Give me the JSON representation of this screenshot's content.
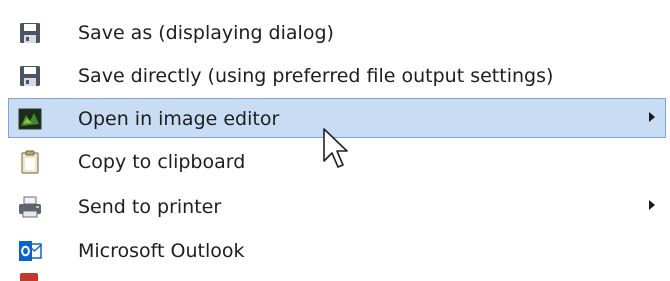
{
  "menu": {
    "items": [
      {
        "icon": "floppy-disk-icon",
        "label": "Save as (displaying dialog)",
        "has_submenu": false,
        "highlighted": false
      },
      {
        "icon": "floppy-disk-icon",
        "label": "Save directly (using preferred file output settings)",
        "has_submenu": false,
        "highlighted": false
      },
      {
        "icon": "image-editor-icon",
        "label": "Open in image editor",
        "has_submenu": true,
        "highlighted": true
      },
      {
        "icon": "clipboard-icon",
        "label": "Copy to clipboard",
        "has_submenu": false,
        "highlighted": false
      },
      {
        "icon": "printer-icon",
        "label": "Send to printer",
        "has_submenu": true,
        "highlighted": false
      },
      {
        "icon": "outlook-icon",
        "label": "Microsoft Outlook",
        "has_submenu": false,
        "highlighted": false
      }
    ]
  },
  "colors": {
    "highlight_bg": "#c8dcf4",
    "highlight_border": "#7aa7d8",
    "text": "#1e1e1e",
    "outlook_blue": "#0a64c8"
  },
  "cursor_icon": "mouse-pointer-icon"
}
